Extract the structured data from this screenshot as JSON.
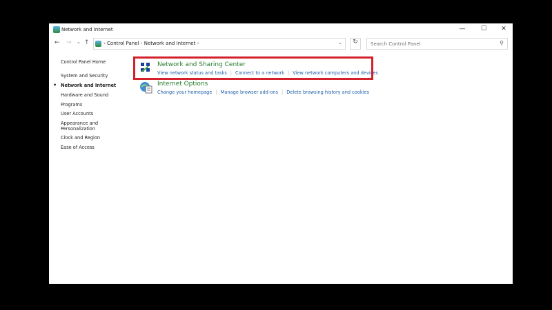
{
  "window": {
    "title": "Network and Internet",
    "controls": [
      "—",
      "☐",
      "✕"
    ]
  },
  "nav": {
    "back": "←",
    "forward": "→",
    "recent": "⌄",
    "up": "↑",
    "breadcrumbs": [
      "Control Panel",
      "Network and Internet"
    ],
    "search_placeholder": "Search Control Panel"
  },
  "sidebar": {
    "home": "Control Panel Home",
    "items": [
      {
        "label": "System and Security"
      },
      {
        "label": "Network and Internet",
        "current": true
      },
      {
        "label": "Hardware and Sound"
      },
      {
        "label": "Programs"
      },
      {
        "label": "User Accounts"
      },
      {
        "label": "Appearance and Personalization"
      },
      {
        "label": "Clock and Region"
      },
      {
        "label": "Ease of Access"
      }
    ]
  },
  "categories": [
    {
      "title": "Network and Sharing Center",
      "links": [
        "View network status and tasks",
        "Connect to a network",
        "View network computers and devices"
      ]
    },
    {
      "title": "Internet Options",
      "links": [
        "Change your homepage",
        "Manage browser add-ons",
        "Delete browsing history and cookies"
      ]
    }
  ],
  "colors": {
    "highlight": "#d3202a",
    "heading": "#267b2b",
    "link": "#1f5fa8"
  }
}
